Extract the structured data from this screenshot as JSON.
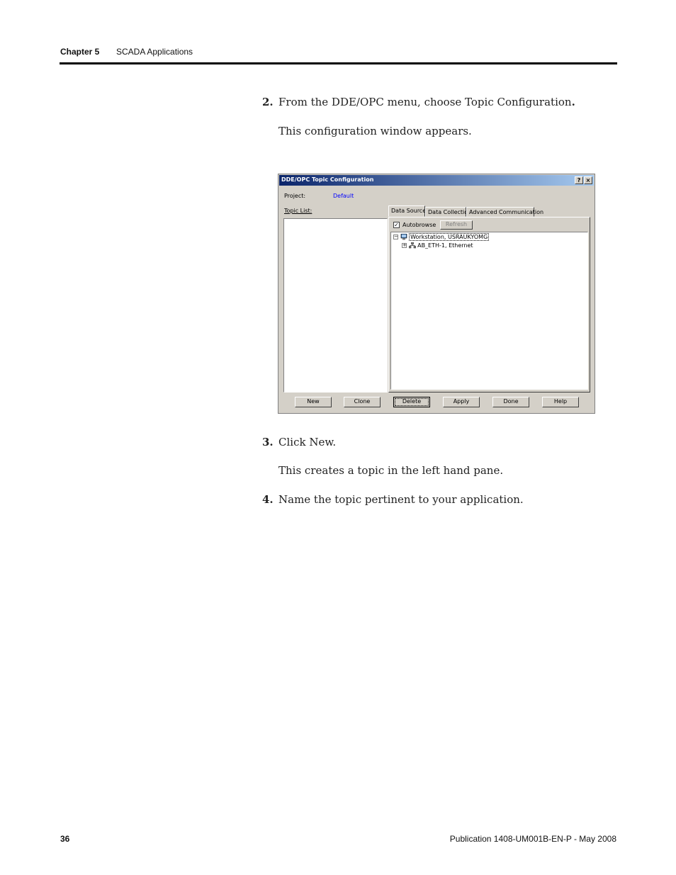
{
  "header": {
    "chapter": "Chapter 5",
    "section": "SCADA Applications"
  },
  "steps": [
    {
      "num": "2.",
      "pre": "From the DDE/OPC menu, choose Topic Configuration",
      "post": "."
    },
    {
      "num": "3.",
      "pre": "Click New.",
      "post": ""
    },
    {
      "num": "4.",
      "pre": "Name the topic pertinent to your application.",
      "post": ""
    }
  ],
  "paragraphs": {
    "after_step2": "This configuration window appears.",
    "after_step3": "This creates a topic in the left hand pane."
  },
  "dialog": {
    "title": "DDE/OPC Topic Configuration",
    "help_btn": "?",
    "close_btn": "×",
    "project_label": "Project:",
    "project_value": "Default",
    "topic_list_label": "Topic List:",
    "tabs": [
      "Data Source",
      "Data Collection",
      "Advanced Communication"
    ],
    "autobrowse_label": "Autobrowse",
    "autobrowse_checked": "✓",
    "refresh_btn": "Refresh",
    "tree": {
      "root": "Workstation, USRAUKYOMG",
      "child": "AB_ETH-1, Ethernet",
      "collapse_sign": "−",
      "expand_sign": "+"
    },
    "buttons": [
      "New",
      "Clone",
      "Delete",
      "Apply",
      "Done",
      "Help"
    ],
    "colors": {
      "titlebar_start": "#0a246a",
      "titlebar_end": "#a6caf0",
      "face": "#d4d0c8",
      "link": "#0000ff"
    }
  },
  "footer": {
    "page": "36",
    "publication": "Publication 1408-UM001B-EN-P - May 2008"
  }
}
